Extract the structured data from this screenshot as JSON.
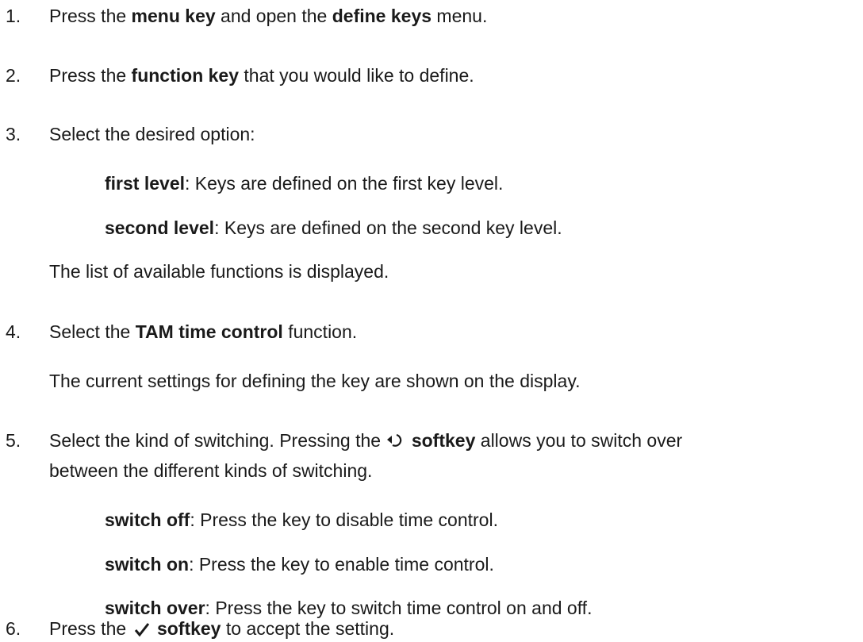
{
  "steps": [
    {
      "number": "1.",
      "parts": [
        "Press the ",
        "menu key",
        " and open the ",
        "define keys",
        " menu."
      ]
    },
    {
      "number": "2.",
      "parts": [
        "Press the ",
        "function key",
        " that you would like to define."
      ]
    },
    {
      "number": "3.",
      "text": "Select the desired option:",
      "options": [
        {
          "term": "first level",
          "desc": ": Keys are defined on the first key level."
        },
        {
          "term": "second level",
          "desc": ": Keys are defined on the second key level."
        }
      ],
      "result": "The list of available functions is displayed."
    },
    {
      "number": "4.",
      "parts": [
        "Select the ",
        "TAM time control",
        " function."
      ],
      "result": "The current settings for defining the key are shown on the display."
    },
    {
      "number": "5.",
      "parts": [
        "Select the kind of switching. Pressing the ",
        "softkey",
        " allows you to switch over"
      ],
      "continuation": "between the different kinds of switching.",
      "icon": "toggle-arrow-icon",
      "options": [
        {
          "term": "switch off",
          "desc": ": Press the key to disable time control."
        },
        {
          "term": "switch on",
          "desc": ": Press the key to enable time control."
        },
        {
          "term": "switch over",
          "desc": ": Press the key to switch time control on and off."
        }
      ]
    },
    {
      "number": "6.",
      "parts": [
        "Press the ",
        "softkey",
        " to accept the setting."
      ],
      "icon": "checkmark-icon"
    }
  ]
}
